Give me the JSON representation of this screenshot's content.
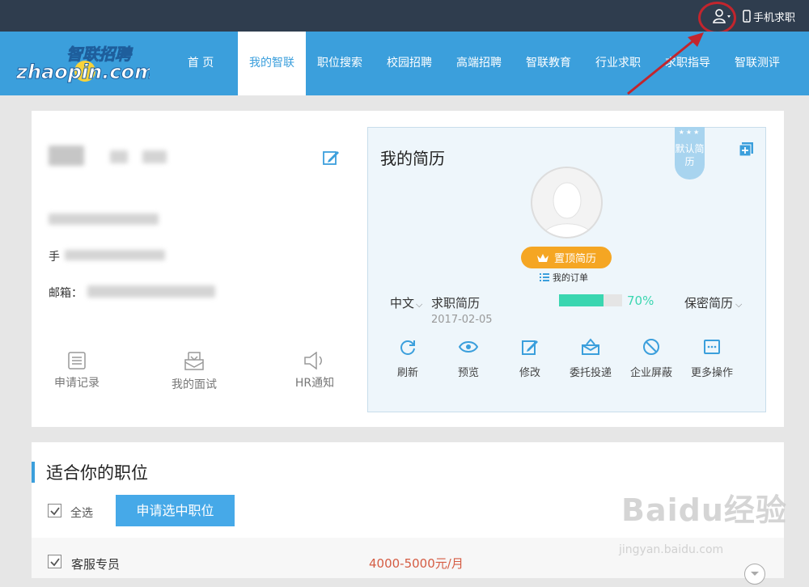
{
  "topbar": {
    "mobile_label": "手机求职"
  },
  "logo": {
    "line1": "智联招聘",
    "line2": "zhaopin.com"
  },
  "nav": {
    "items": [
      {
        "label": "首 页"
      },
      {
        "label": "我的智联"
      },
      {
        "label": "职位搜索"
      },
      {
        "label": "校园招聘"
      },
      {
        "label": "高端招聘"
      },
      {
        "label": "智联教育"
      },
      {
        "label": "行业求职"
      },
      {
        "label": "求职指导"
      },
      {
        "label": "智联测评"
      }
    ],
    "active": "我的智联"
  },
  "profile": {
    "phone_label": "手",
    "email_label": "邮箱：",
    "quick_links": [
      {
        "label": "申请记录",
        "icon": "list-doc-icon"
      },
      {
        "label": "我的面试",
        "icon": "inbox-icon"
      },
      {
        "label": "HR通知",
        "icon": "speaker-icon"
      }
    ]
  },
  "resume": {
    "title": "我的简历",
    "default_tag": "默认简历",
    "top_button": "置顶简历",
    "orders_link": "我的订单",
    "language": "中文",
    "name": "求职简历",
    "date": "2017-02-05",
    "completion": 70,
    "completion_label": "70%",
    "privacy": "保密简历",
    "actions": [
      {
        "label": "刷新",
        "icon": "refresh-icon"
      },
      {
        "label": "预览",
        "icon": "eye-icon"
      },
      {
        "label": "修改",
        "icon": "edit-icon"
      },
      {
        "label": "委托投递",
        "icon": "delegate-send-icon"
      },
      {
        "label": "企业屏蔽",
        "icon": "block-icon"
      },
      {
        "label": "更多操作",
        "icon": "more-icon"
      }
    ]
  },
  "jobs": {
    "section_title": "适合你的职位",
    "select_all_label": "全选",
    "apply_button": "申请选中职位",
    "rows": [
      {
        "title": "客服专员",
        "salary": "4000-5000元/月"
      }
    ]
  },
  "watermark": {
    "main": "Baidu经验",
    "sub": "jingyan.baidu.com"
  },
  "colors": {
    "topbar": "#2f3d4e",
    "nav": "#3b9fdc",
    "highlight": "#c2252d",
    "progress": "#3ad6b0",
    "orange": "#f5a623",
    "salary": "#d55c43"
  }
}
